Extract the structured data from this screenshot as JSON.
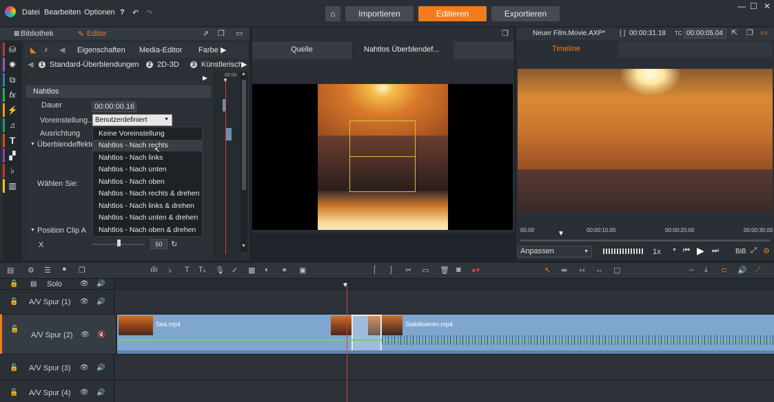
{
  "menu": {
    "items": [
      "Datei",
      "Bearbeiten",
      "Optionen"
    ],
    "help": "?"
  },
  "modes": {
    "home": "⌂",
    "import": "Importieren",
    "edit": "Editieren",
    "export": "Exportieren"
  },
  "window": {
    "min": "—",
    "max": "☐",
    "close": "✕"
  },
  "left_panel": {
    "tab_library": "Bibliothek",
    "tab_editor": "Editor",
    "subtabs": [
      "Eigenschaften",
      "Media-Editor",
      "Farbe"
    ],
    "categories": [
      {
        "num": "1",
        "label": "Standard-Überblendungen"
      },
      {
        "num": "2",
        "label": "2D-3D"
      },
      {
        "num": "3",
        "label": "Künstlerisch"
      }
    ],
    "section": "Nahtlos",
    "duration_label": "Dauer",
    "duration_value": "00:00:00.16",
    "preset_label": "Voreinstellung...",
    "preset_value": "Benutzerdefiniert",
    "orientation_label": "Ausrichtung",
    "effects_label": "Überblendeffekte",
    "choose_label": "Wählen Sie:",
    "position_label": "Position Clip A",
    "x_label": "X",
    "x_value": "50",
    "mini_time": "00:00",
    "dropdown": [
      "Keine Voreinstellung",
      "Nahtlos - Nach rechts",
      "Nahtlos - Nach links",
      "Nahtlos - Nach unten",
      "Nahtlos - Nach oben",
      "Nahtlos - Nach rechts & drehen",
      "Nahtlos - Nach links & drehen",
      "Nahtlos - Nach unten & drehen",
      "Nahtlos - Nach oben & drehen"
    ],
    "dropdown_selected": 1
  },
  "mid_panel": {
    "tab_source": "Quelle",
    "tab_transition": "Nahtlos Überblendef..."
  },
  "right_panel": {
    "project": "Neuer Film.Movie.AXP*",
    "brackets": "[ ]",
    "duration": "00:00:31.18",
    "tc_label": "TC",
    "tc": "00:00:05.04",
    "tab": "Timeline",
    "ruler": [
      "00.00",
      "00:00:10.00",
      "00:00:20.00",
      "00:00:30.00"
    ],
    "fit": "Anpassen",
    "speed": "1x",
    "bib": "BiB"
  },
  "tracks": [
    {
      "name": "Solo"
    },
    {
      "name": "A/V Spur (1)"
    },
    {
      "name": "A/V Spur (2)",
      "clips": [
        "Sea.mp4",
        "Stabilisieren.mp4"
      ]
    },
    {
      "name": "A/V Spur (3)"
    },
    {
      "name": "A/V Spur (4)"
    }
  ],
  "colors": {
    "accent": "#f27c1c",
    "clip": "#7fa6cf",
    "playhead": "#d24040"
  }
}
